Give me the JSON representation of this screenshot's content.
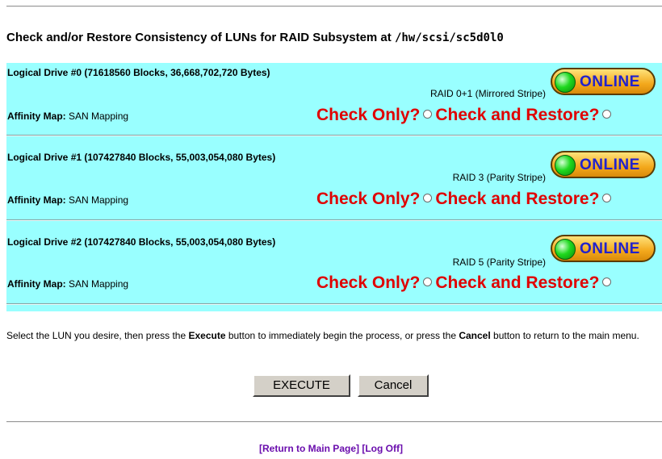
{
  "header": {
    "title_prefix": "Check and/or Restore Consistency of LUNs for RAID Subsystem at ",
    "subsystem_path": "/hw/scsi/sc5d0l0"
  },
  "drives": [
    {
      "name": "Logical Drive #0 (71618560 Blocks, 36,668,702,720 Bytes)",
      "raid": "RAID 0+1 (Mirrored Stripe)",
      "status": "ONLINE",
      "affinity_label": "Affinity Map:",
      "affinity_value": "SAN Mapping",
      "check_only": "Check Only?",
      "check_restore": "Check and Restore?"
    },
    {
      "name": "Logical Drive #1 (107427840 Blocks, 55,003,054,080 Bytes)",
      "raid": "RAID 3 (Parity Stripe)",
      "status": "ONLINE",
      "affinity_label": "Affinity Map:",
      "affinity_value": "SAN Mapping",
      "check_only": "Check Only?",
      "check_restore": "Check and Restore?"
    },
    {
      "name": "Logical Drive #2 (107427840 Blocks, 55,003,054,080 Bytes)",
      "raid": "RAID 5 (Parity Stripe)",
      "status": "ONLINE",
      "affinity_label": "Affinity Map:",
      "affinity_value": "SAN Mapping",
      "check_only": "Check Only?",
      "check_restore": "Check and Restore?"
    }
  ],
  "instructions": {
    "part1": "Select the LUN you desire, then press the ",
    "execute_word": "Execute",
    "part2": " button to immediately begin the process, or press the ",
    "cancel_word": "Cancel",
    "part3": " button to return to the main menu."
  },
  "buttons": {
    "execute": "EXECUTE",
    "cancel": "Cancel"
  },
  "footer": {
    "return_link": "[Return to Main Page]",
    "logoff_link": "[Log Off]"
  },
  "colors": {
    "panel_bg": "#99ffff",
    "check_text": "#e00000",
    "link": "#6a0dad",
    "online_text": "#2222cc"
  },
  "icons": {
    "status": "green-led-icon"
  }
}
